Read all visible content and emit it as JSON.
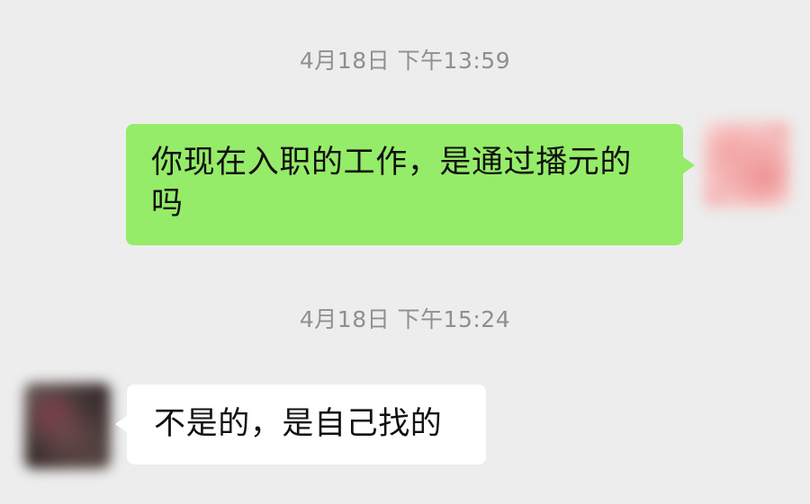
{
  "messages": [
    {
      "timestamp": "4月18日 下午13:59",
      "direction": "outgoing",
      "text": "你现在入职的工作，是通过播元的吗"
    },
    {
      "timestamp": "4月18日 下午15:24",
      "direction": "incoming",
      "text": "不是的，是自己找的"
    }
  ],
  "colors": {
    "background": "#ededed",
    "outgoing_bubble": "#95ec69",
    "incoming_bubble": "#ffffff",
    "timestamp_text": "#8f8f8f",
    "message_text": "#111111"
  }
}
